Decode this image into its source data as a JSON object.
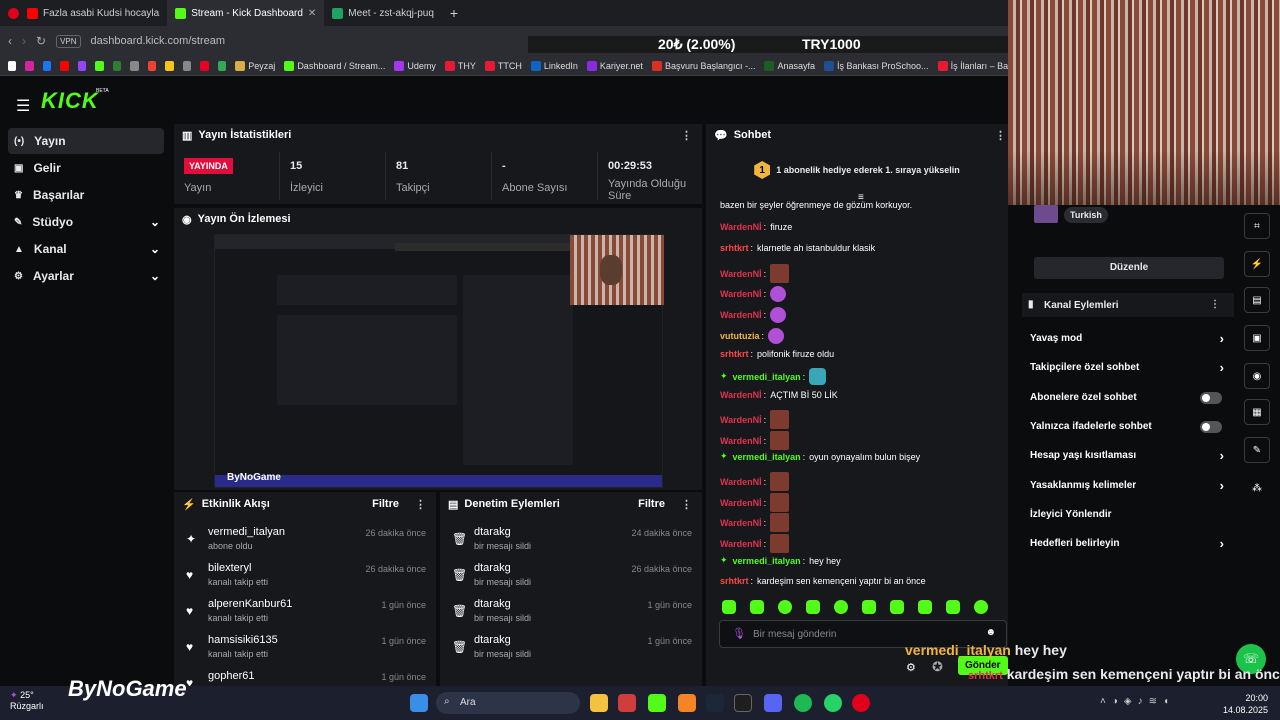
{
  "browser": {
    "tabs": [
      {
        "label": "Fazla asabi Kudsi hocayla",
        "color": "#ff0000"
      },
      {
        "label": "Stream - Kick Dashboard",
        "color": "#53fc18"
      },
      {
        "label": "Meet - zst-akqj-puq",
        "color": "#1ea362"
      }
    ],
    "new_tab": "+",
    "vpn": "VPN",
    "url": "dashboard.kick.com/stream",
    "ticker": {
      "left": "20₺ (2.00%)",
      "right": "TRY1000"
    },
    "bookmarks": [
      {
        "label": "Peyzaj",
        "color": "#d8b04a"
      },
      {
        "label": "Dashboard / Stream...",
        "color": "#53fc18"
      },
      {
        "label": "Udemy",
        "color": "#a435f0"
      },
      {
        "label": "THY",
        "color": "#e81932"
      },
      {
        "label": "TTCH",
        "color": "#e81932"
      },
      {
        "label": "LinkedIn",
        "color": "#0a66c2"
      },
      {
        "label": "Kariyer.net",
        "color": "#8a2be2"
      },
      {
        "label": "Başvuru Başlangıcı -...",
        "color": "#d93025"
      },
      {
        "label": "Anasayfa",
        "color": "#1b5e20"
      },
      {
        "label": "İş Bankası ProSchoo...",
        "color": "#1d4f91"
      },
      {
        "label": "İş İlanları – Ba",
        "color": "#e81932"
      }
    ]
  },
  "kick": {
    "logo": "KICK",
    "beta": "BETA"
  },
  "sidebar": {
    "items": [
      {
        "label": "Yayın",
        "icon": "broadcast-icon",
        "glyph": "(•)",
        "active": true
      },
      {
        "label": "Gelir",
        "icon": "revenue-icon",
        "glyph": "▣"
      },
      {
        "label": "Başarılar",
        "icon": "trophy-icon",
        "glyph": "♛"
      },
      {
        "label": "Stüdyo",
        "icon": "studio-icon",
        "glyph": "✎",
        "chevron": true
      },
      {
        "label": "Kanal",
        "icon": "channel-icon",
        "glyph": "▲",
        "chevron": true
      },
      {
        "label": "Ayarlar",
        "icon": "settings-icon",
        "glyph": "⚙",
        "chevron": true
      }
    ]
  },
  "stats": {
    "title": "Yayın İstatistikleri",
    "live_badge": "YAYINDA",
    "status_label": "Yayın",
    "items": [
      {
        "value": "15",
        "label": "İzleyici"
      },
      {
        "value": "81",
        "label": "Takipçi"
      },
      {
        "value": "-",
        "label": "Abone Sayısı"
      },
      {
        "value": "00:29:53",
        "label": "Yayında Olduğu Süre"
      }
    ]
  },
  "preview": {
    "title": "Yayın Ön İzlemesi",
    "watermark": "ByNoGame"
  },
  "activity": {
    "title": "Etkinlik Akışı",
    "filter": "Filtre",
    "items": [
      {
        "name": "vermedi_italyan",
        "sub": "abone oldu",
        "time": "26 dakika önce",
        "icon": "sparkle-icon",
        "glyph": "✦"
      },
      {
        "name": "bilexteryl",
        "sub": "kanalı takip etti",
        "time": "26 dakika önce",
        "icon": "heart-icon",
        "glyph": "♥"
      },
      {
        "name": "alperenKanbur61",
        "sub": "kanalı takip etti",
        "time": "1 gün önce",
        "icon": "heart-icon",
        "glyph": "♥"
      },
      {
        "name": "hamsisiki6135",
        "sub": "kanalı takip etti",
        "time": "1 gün önce",
        "icon": "heart-icon",
        "glyph": "♥"
      },
      {
        "name": "gopher61",
        "sub": "",
        "time": "1 gün önce",
        "icon": "heart-icon",
        "glyph": "♥"
      }
    ]
  },
  "moderation": {
    "title": "Denetim Eylemleri",
    "filter": "Filtre",
    "items": [
      {
        "name": "dtarakg",
        "sub": "bir mesajı sildi",
        "time": "24 dakika önce"
      },
      {
        "name": "dtarakg",
        "sub": "bir mesajı sildi",
        "time": "26 dakika önce"
      },
      {
        "name": "dtarakg",
        "sub": "bir mesajı sildi",
        "time": "1 gün önce"
      },
      {
        "name": "dtarakg",
        "sub": "bir mesajı sildi",
        "time": "1 gün önce"
      }
    ]
  },
  "chat": {
    "title": "Sohbet",
    "gift_banner": "1 abonelik hediye ederek 1. sıraya yükselin",
    "gift_rank": "1",
    "input_placeholder": "Bir mesaj gönderin",
    "send": "Gönder",
    "messages": [
      {
        "user": "",
        "text": "bazen bir şeyler öğrenmeye de gözüm korkuyor."
      },
      {
        "user": "WardenNİ",
        "text": "firuze"
      },
      {
        "user": "srhtkrt",
        "text": "klarnetle ah istanbuldur klasik"
      },
      {
        "user": "WardenNİ",
        "text": "",
        "emote": "img"
      },
      {
        "user": "WardenNİ",
        "text": "",
        "emote": "p"
      },
      {
        "user": "WardenNİ",
        "text": "",
        "emote": "p"
      },
      {
        "user": "vututuzia",
        "text": "",
        "emote": "p"
      },
      {
        "user": "srhtkrt",
        "text": "polifonik firuze oldu"
      },
      {
        "user": "vermedi_italyan",
        "text": "",
        "emote": "c",
        "sub": true
      },
      {
        "user": "WardenNİ",
        "text": "AÇTIM Bİ 50 LİK"
      },
      {
        "user": "WardenNİ",
        "text": "",
        "emote": "img"
      },
      {
        "user": "WardenNİ",
        "text": "",
        "emote": "img"
      },
      {
        "user": "vermedi_italyan",
        "text": "oyun oynayalım bulun bişey",
        "sub": true
      },
      {
        "user": "WardenNİ",
        "text": "",
        "emote": "img"
      },
      {
        "user": "WardenNİ",
        "text": "",
        "emote": "img"
      },
      {
        "user": "WardenNİ",
        "text": "",
        "emote": "img"
      },
      {
        "user": "WardenNİ",
        "text": "",
        "emote": "img"
      },
      {
        "user": "vermedi_italyan",
        "text": "hey hey",
        "sub": true
      },
      {
        "user": "srhtkrt",
        "text": "kardeşim sen kemençeni yaptır bi an önce"
      }
    ]
  },
  "channel": {
    "language": "Turkish",
    "edit": "Düzenle",
    "actions_title": "Kanal Eylemleri",
    "actions": [
      {
        "label": "Yavaş mod",
        "kind": "chevron"
      },
      {
        "label": "Takipçilere özel sohbet",
        "kind": "chevron"
      },
      {
        "label": "Abonelere özel sohbet",
        "kind": "toggle"
      },
      {
        "label": "Yalnızca ifadelerle sohbet",
        "kind": "toggle"
      },
      {
        "label": "Hesap yaşı kısıtlaması",
        "kind": "chevron"
      },
      {
        "label": "Yasaklanmış kelimeler",
        "kind": "chevron"
      },
      {
        "label": "İzleyici Yönlendir",
        "kind": "none"
      },
      {
        "label": "Hedefleri belirleyin",
        "kind": "chevron"
      }
    ]
  },
  "overlay": {
    "brand": "ByNoGame",
    "chat": [
      {
        "user": "vermedi_italyan",
        "text": "hey hey"
      },
      {
        "user": "srhtkrt",
        "text": "kardeşim sen kemençeni yaptır bi an önce"
      }
    ]
  },
  "taskbar": {
    "weather_temp": "25°",
    "weather_label": "Rüzgarlı",
    "search": "Ara",
    "time": "20:00",
    "date": "14.08.2025"
  }
}
